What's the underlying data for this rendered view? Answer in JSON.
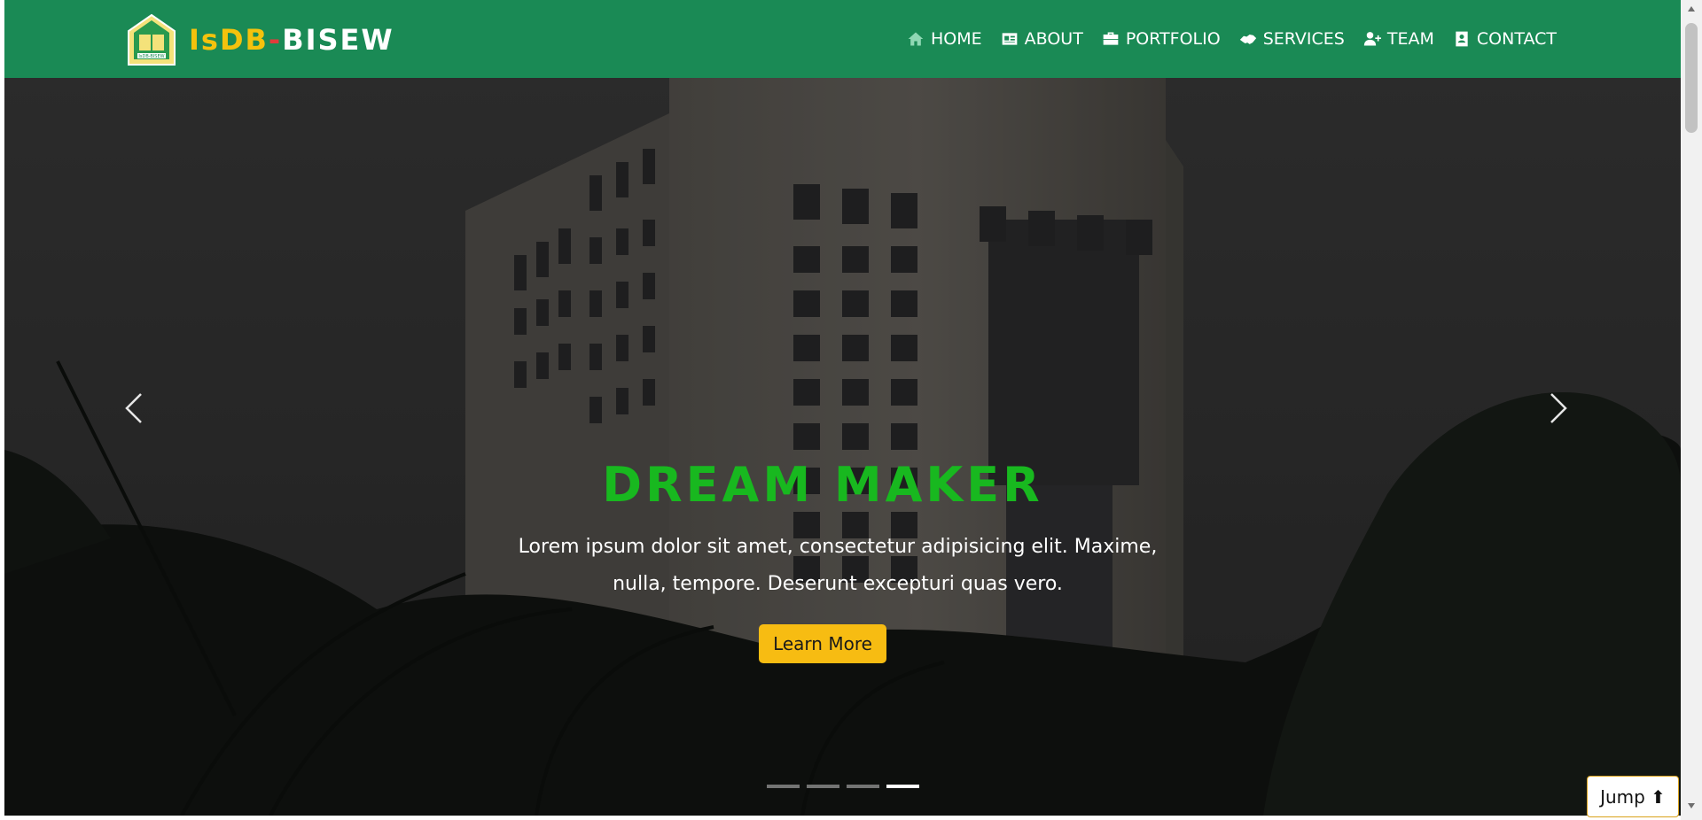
{
  "brand": {
    "part1": "IsDB",
    "dash": "-",
    "part2": "BISEW",
    "logo_text": "IsDB-BISEW"
  },
  "nav": {
    "items": [
      {
        "label": "HOME",
        "icon": "home-icon"
      },
      {
        "label": "ABOUT",
        "icon": "id-card-icon"
      },
      {
        "label": "PORTFOLIO",
        "icon": "briefcase-icon"
      },
      {
        "label": "SERVICES",
        "icon": "handshake-icon"
      },
      {
        "label": "TEAM",
        "icon": "user-plus-icon"
      },
      {
        "label": "CONTACT",
        "icon": "address-book-icon"
      }
    ]
  },
  "hero": {
    "title": "DREAM MAKER",
    "text": "Lorem ipsum dolor sit amet, consectetur adipisicing elit. Maxime, nulla, tempore. Deserunt excepturi quas vero.",
    "button_label": "Learn More",
    "slides_total": 4,
    "active_slide": 4
  },
  "jump": {
    "label": "Jump ⬆"
  },
  "colors": {
    "navbar": "#1a8a55",
    "brand_yellow": "#f4c20d",
    "title_green": "#18b81f",
    "button_yellow": "#f7bc12"
  }
}
